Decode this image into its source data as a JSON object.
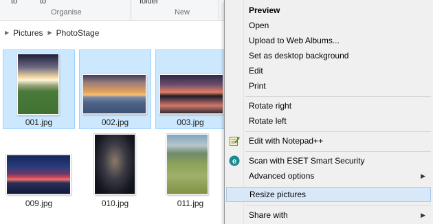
{
  "ribbon": {
    "frag1": "to",
    "frag2": "to",
    "frag3": "folder",
    "group_organise": "Organise",
    "group_new": "New"
  },
  "breadcrumb": [
    "Pictures",
    "PhotoStage"
  ],
  "files": [
    {
      "name": "001.jpg",
      "selected": true
    },
    {
      "name": "002.jpg",
      "selected": true
    },
    {
      "name": "003.jpg",
      "selected": true
    },
    {
      "name": "009.jpg",
      "selected": false
    },
    {
      "name": "010.jpg",
      "selected": false
    },
    {
      "name": "011.jpg",
      "selected": false
    }
  ],
  "context_menu": {
    "preview": "Preview",
    "open": "Open",
    "upload": "Upload to Web Albums...",
    "set_desktop": "Set as desktop background",
    "edit": "Edit",
    "print": "Print",
    "rotate_right": "Rotate right",
    "rotate_left": "Rotate left",
    "edit_notepad": "Edit with Notepad++",
    "scan_eset": "Scan with ESET Smart Security",
    "advanced": "Advanced options",
    "resize": "Resize pictures",
    "share": "Share with"
  },
  "colors": {
    "selection_bg": "#cce8ff",
    "selection_border": "#99d1ff",
    "menu_highlight": "#d8e8f8",
    "eset_icon": "#1a8a8f"
  }
}
